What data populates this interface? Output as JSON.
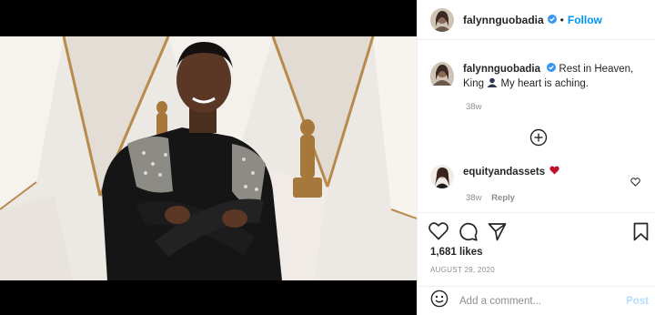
{
  "colors": {
    "link_blue": "#0095f6",
    "muted_grey": "#8e8e8e",
    "post_disabled": "#b2dffc",
    "heart_red": "#c0102a"
  },
  "header": {
    "username": "falynnguobadia",
    "separator": "•",
    "follow_label": "Follow"
  },
  "caption": {
    "username": "falynnguobadia",
    "text_before_icon": "Rest in Heaven, King",
    "text_after_icon": "My heart is aching.",
    "inline_icon": "bust-silhouette-icon",
    "age": "38w"
  },
  "load_more_icon": "plus-circle-icon",
  "comment": {
    "username": "equityandassets",
    "icon": "red-heart-icon",
    "age": "38w",
    "reply_label": "Reply"
  },
  "actions": {
    "icons": [
      "heart-icon",
      "comment-icon",
      "share-icon",
      "bookmark-icon"
    ]
  },
  "likes": "1,681 likes",
  "date": "AUGUST 29, 2020",
  "add_comment": {
    "placeholder": "Add a comment...",
    "post_label": "Post"
  }
}
